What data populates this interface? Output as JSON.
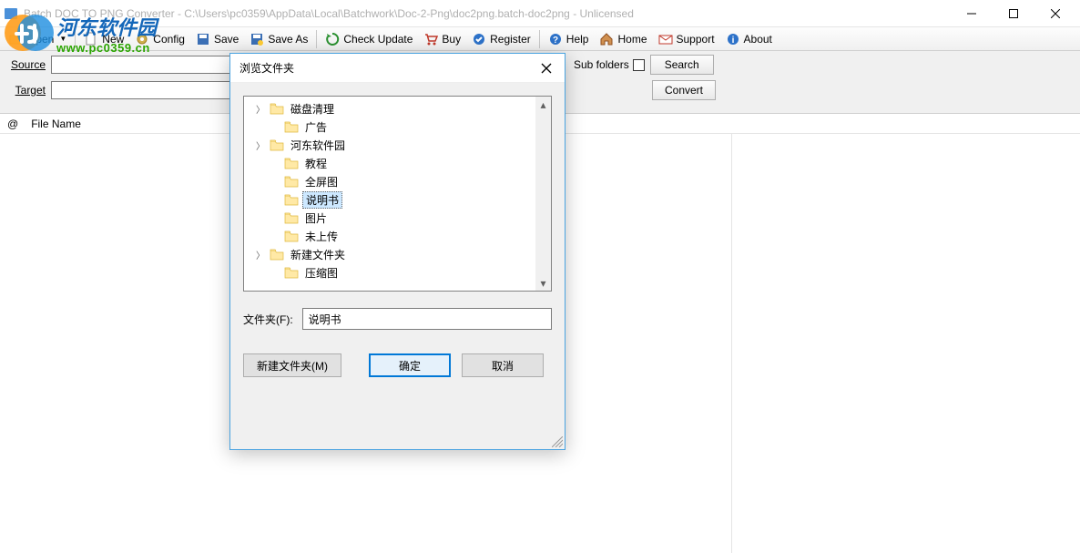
{
  "titlebar": {
    "title": "Batch DOC TO PNG Converter - C:\\Users\\pc0359\\AppData\\Local\\Batchwork\\Doc-2-Png\\doc2png.batch-doc2png - Unlicensed"
  },
  "watermark": {
    "cn": "河东软件园",
    "url": "www.pc0359.cn"
  },
  "toolbar": {
    "open": "Open",
    "new": "New",
    "config": "Config",
    "save": "Save",
    "saveas": "Save As",
    "check": "Check Update",
    "buy": "Buy",
    "register": "Register",
    "help": "Help",
    "home": "Home",
    "support": "Support",
    "about": "About"
  },
  "form": {
    "source_label": "Source",
    "target_label": "Target",
    "subfolders_label": "Sub folders",
    "search_btn": "Search",
    "convert_btn": "Convert"
  },
  "list": {
    "col_at": "@",
    "col_filename": "File Name"
  },
  "dialog": {
    "title": "浏览文件夹",
    "tree": [
      {
        "label": "磁盘清理",
        "expandable": true,
        "level": 1
      },
      {
        "label": "广告",
        "expandable": false,
        "level": 2
      },
      {
        "label": "河东软件园",
        "expandable": true,
        "level": 1
      },
      {
        "label": "教程",
        "expandable": false,
        "level": 2
      },
      {
        "label": "全屏图",
        "expandable": false,
        "level": 2
      },
      {
        "label": "说明书",
        "expandable": false,
        "level": 2,
        "selected": true
      },
      {
        "label": "图片",
        "expandable": false,
        "level": 2
      },
      {
        "label": "未上传",
        "expandable": false,
        "level": 2
      },
      {
        "label": "新建文件夹",
        "expandable": true,
        "level": 1
      },
      {
        "label": "压缩图",
        "expandable": false,
        "level": 2
      }
    ],
    "folder_label": "文件夹(F):",
    "folder_value": "说明书",
    "newfolder_btn": "新建文件夹(M)",
    "ok_btn": "确定",
    "cancel_btn": "取消"
  }
}
